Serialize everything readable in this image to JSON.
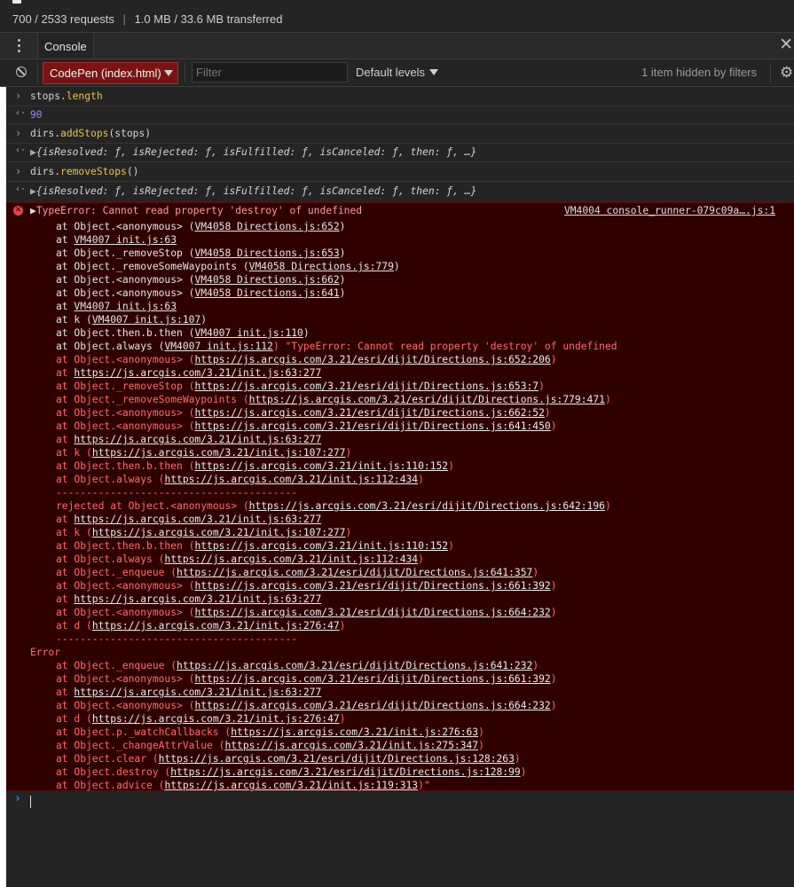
{
  "status": {
    "requests_text": "700 / 2533 requests",
    "separator": "|",
    "transfer_text": "1.0 MB / 33.6 MB transferred"
  },
  "drawer": {
    "tab_label": "Console",
    "close_icon": "✕"
  },
  "toolbar": {
    "context_label": "CodePen (index.html)",
    "filter_placeholder": "Filter",
    "levels_label": "Default levels",
    "hidden_text": "1 item hidden by filters"
  },
  "console": {
    "entries": [
      {
        "type": "input",
        "text": "stops.length"
      },
      {
        "type": "output",
        "text": "90"
      },
      {
        "type": "input",
        "text": "dirs.addStops(stops)"
      },
      {
        "type": "output",
        "text": "{isResolved: ƒ, isRejected: ƒ, isFulfilled: ƒ, isCanceled: ƒ, then: ƒ, …}"
      },
      {
        "type": "input",
        "text": "dirs.removeStops()"
      },
      {
        "type": "output",
        "text": "{isResolved: ƒ, isRejected: ƒ, isFulfilled: ƒ, isCanceled: ƒ, then: ƒ, …}"
      }
    ],
    "error": {
      "header": "TypeError: Cannot read property 'destroy' of undefined",
      "location": "VM4004 console_runner-079c09a….js:1",
      "lines": [
        {
          "pre": "at Object.<anonymous> (",
          "link": "VM4058 Directions.js:652",
          "post": ")",
          "style": "w"
        },
        {
          "pre": "at ",
          "link": "VM4007 init.js:63",
          "post": "",
          "style": "w"
        },
        {
          "pre": "at Object._removeStop (",
          "link": "VM4058 Directions.js:653",
          "post": ")",
          "style": "w"
        },
        {
          "pre": "at Object._removeSomeWaypoints (",
          "link": "VM4058 Directions.js:779",
          "post": ")",
          "style": "w"
        },
        {
          "pre": "at Object.<anonymous> (",
          "link": "VM4058 Directions.js:662",
          "post": ")",
          "style": "w"
        },
        {
          "pre": "at Object.<anonymous> (",
          "link": "VM4058 Directions.js:641",
          "post": ")",
          "style": "w"
        },
        {
          "pre": "at ",
          "link": "VM4007 init.js:63",
          "post": "",
          "style": "w"
        },
        {
          "pre": "at k (",
          "link": "VM4007 init.js:107",
          "post": ")",
          "style": "w"
        },
        {
          "pre": "at Object.then.b.then (",
          "link": "VM4007 init.js:110",
          "post": ")",
          "style": "w"
        },
        {
          "pre": "at Object.always (",
          "link": "VM4007 init.js:112",
          "post": ") \"TypeError: Cannot read property 'destroy' of undefined",
          "style": "w",
          "post_red": true
        },
        {
          "pre": "at Object.<anonymous> (",
          "link": "https://js.arcgis.com/3.21/esri/dijit/Directions.js:652:206",
          "post": ")",
          "style": "r"
        },
        {
          "pre": "at ",
          "link": "https://js.arcgis.com/3.21/init.js:63:277",
          "post": "",
          "style": "r"
        },
        {
          "pre": "at Object._removeStop (",
          "link": "https://js.arcgis.com/3.21/esri/dijit/Directions.js:653:7",
          "post": ")",
          "style": "r"
        },
        {
          "pre": "at Object._removeSomeWaypoints (",
          "link": "https://js.arcgis.com/3.21/esri/dijit/Directions.js:779:471",
          "post": ")",
          "style": "r"
        },
        {
          "pre": "at Object.<anonymous> (",
          "link": "https://js.arcgis.com/3.21/esri/dijit/Directions.js:662:52",
          "post": ")",
          "style": "r"
        },
        {
          "pre": "at Object.<anonymous> (",
          "link": "https://js.arcgis.com/3.21/esri/dijit/Directions.js:641:450",
          "post": ")",
          "style": "r"
        },
        {
          "pre": "at ",
          "link": "https://js.arcgis.com/3.21/init.js:63:277",
          "post": "",
          "style": "r"
        },
        {
          "pre": "at k (",
          "link": "https://js.arcgis.com/3.21/init.js:107:277",
          "post": ")",
          "style": "r"
        },
        {
          "pre": "at Object.then.b.then (",
          "link": "https://js.arcgis.com/3.21/init.js:110:152",
          "post": ")",
          "style": "r"
        },
        {
          "pre": "at Object.always (",
          "link": "https://js.arcgis.com/3.21/init.js:112:434",
          "post": ")",
          "style": "r"
        },
        {
          "pre": "----------------------------------------",
          "link": "",
          "post": "",
          "style": "r"
        },
        {
          "pre": "rejected at Object.<anonymous> (",
          "link": "https://js.arcgis.com/3.21/esri/dijit/Directions.js:642:196",
          "post": ")",
          "style": "r"
        },
        {
          "pre": "at ",
          "link": "https://js.arcgis.com/3.21/init.js:63:277",
          "post": "",
          "style": "r"
        },
        {
          "pre": "at k (",
          "link": "https://js.arcgis.com/3.21/init.js:107:277",
          "post": ")",
          "style": "r"
        },
        {
          "pre": "at Object.then.b.then (",
          "link": "https://js.arcgis.com/3.21/init.js:110:152",
          "post": ")",
          "style": "r"
        },
        {
          "pre": "at Object.always (",
          "link": "https://js.arcgis.com/3.21/init.js:112:434",
          "post": ")",
          "style": "r"
        },
        {
          "pre": "at Object._enqueue (",
          "link": "https://js.arcgis.com/3.21/esri/dijit/Directions.js:641:357",
          "post": ")",
          "style": "r"
        },
        {
          "pre": "at Object.<anonymous> (",
          "link": "https://js.arcgis.com/3.21/esri/dijit/Directions.js:661:392",
          "post": ")",
          "style": "r"
        },
        {
          "pre": "at ",
          "link": "https://js.arcgis.com/3.21/init.js:63:277",
          "post": "",
          "style": "r"
        },
        {
          "pre": "at Object.<anonymous> (",
          "link": "https://js.arcgis.com/3.21/esri/dijit/Directions.js:664:232",
          "post": ")",
          "style": "r"
        },
        {
          "pre": "at d (",
          "link": "https://js.arcgis.com/3.21/init.js:276:47",
          "post": ")",
          "style": "r"
        },
        {
          "pre": "----------------------------------------",
          "link": "",
          "post": "",
          "style": "r"
        },
        {
          "pre": "Error",
          "link": "",
          "post": "",
          "style": "r",
          "outdent": true
        },
        {
          "pre": "at Object._enqueue (",
          "link": "https://js.arcgis.com/3.21/esri/dijit/Directions.js:641:232",
          "post": ")",
          "style": "r"
        },
        {
          "pre": "at Object.<anonymous> (",
          "link": "https://js.arcgis.com/3.21/esri/dijit/Directions.js:661:392",
          "post": ")",
          "style": "r"
        },
        {
          "pre": "at ",
          "link": "https://js.arcgis.com/3.21/init.js:63:277",
          "post": "",
          "style": "r"
        },
        {
          "pre": "at Object.<anonymous> (",
          "link": "https://js.arcgis.com/3.21/esri/dijit/Directions.js:664:232",
          "post": ")",
          "style": "r"
        },
        {
          "pre": "at d (",
          "link": "https://js.arcgis.com/3.21/init.js:276:47",
          "post": ")",
          "style": "r"
        },
        {
          "pre": "at Object.p._watchCallbacks (",
          "link": "https://js.arcgis.com/3.21/init.js:276:63",
          "post": ")",
          "style": "r"
        },
        {
          "pre": "at Object._changeAttrValue (",
          "link": "https://js.arcgis.com/3.21/init.js:275:347",
          "post": ")",
          "style": "r"
        },
        {
          "pre": "at Object.clear (",
          "link": "https://js.arcgis.com/3.21/esri/dijit/Directions.js:128:263",
          "post": ")",
          "style": "r"
        },
        {
          "pre": "at Object.destroy (",
          "link": "https://js.arcgis.com/3.21/esri/dijit/Directions.js:128:99",
          "post": ")",
          "style": "r"
        },
        {
          "pre": "at Object.advice (",
          "link": "https://js.arcgis.com/3.21/init.js:119:313",
          "post": ")\"",
          "style": "r"
        }
      ]
    }
  },
  "colors": {
    "error_bg": "#2f0000",
    "error_text": "#ff6b6b",
    "context_bg": "#7a1414",
    "prompt_blue": "#3ea3ff",
    "number_purple": "#9e88ff",
    "method_yellow": "#e7c547"
  }
}
